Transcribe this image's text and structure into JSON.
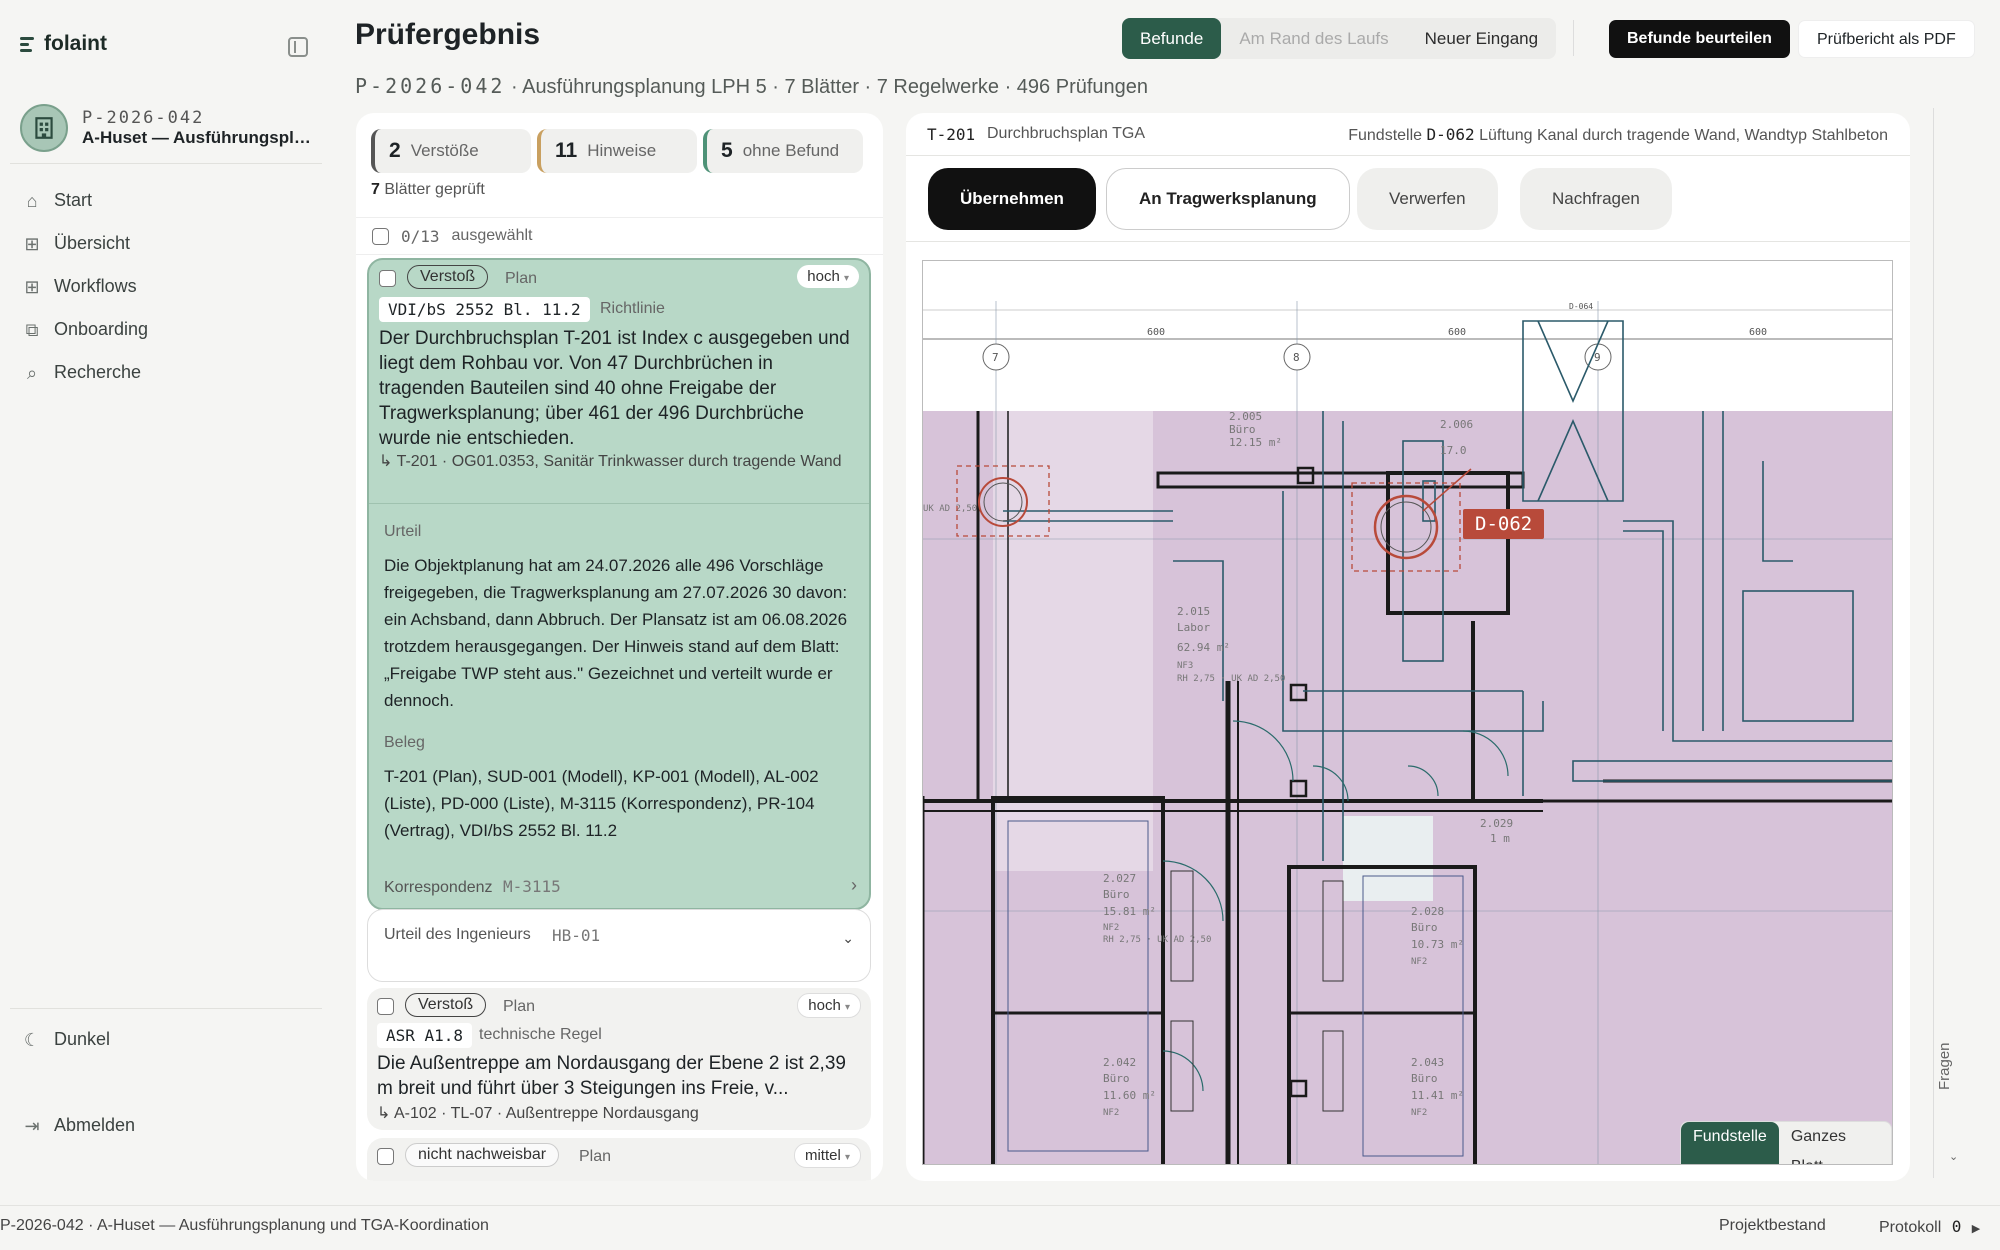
{
  "brand": {
    "name": "folaint"
  },
  "project": {
    "id": "P-2026-042",
    "name": "A-Huset — Ausführungsplanung und TGA-Koordination"
  },
  "nav": {
    "items": [
      {
        "label": "Start",
        "icon": "home-icon"
      },
      {
        "label": "Übersicht",
        "icon": "grid-icon"
      },
      {
        "label": "Workflows",
        "icon": "workflow-icon"
      },
      {
        "label": "Onboarding",
        "icon": "onboarding-icon"
      },
      {
        "label": "Recherche",
        "icon": "search-icon"
      }
    ],
    "dark_label": "Dunkel",
    "logout_label": "Abmelden"
  },
  "header": {
    "title": "Prüfergebnis",
    "subtitle_id": "P-2026-042",
    "subtitle_rest": "· Ausführungsplanung LPH 5 · 7 Blätter · 7 Regelwerke · 496 Prüfungen",
    "tabs": [
      "Befunde",
      "Am Rand des Laufs",
      "Neuer Eingang"
    ],
    "assess_label": "Befunde beurteilen",
    "pdf_label": "Prüfbericht als PDF"
  },
  "summary": {
    "violations_count": "2",
    "violations_label": "Verstöße",
    "hints_count": "11",
    "hints_label": "Hinweise",
    "ok_count": "5",
    "ok_label": "ohne Befund",
    "sheets_count": "7",
    "sheets_label": "Blätter geprüft",
    "selected": "0/13",
    "selected_label": "ausgewählt"
  },
  "findings": [
    {
      "type": "Verstoß",
      "scope": "Plan",
      "severity": "hoch",
      "rule": "VDI/bS 2552 Bl. 11.2",
      "rule_kind": "Richtlinie",
      "text": "Der Durchbruchsplan T-201 ist Index c ausgegeben und liegt dem Rohbau vor. Von 47 Durchbrüchen in tragenden Bauteilen sind 40 ohne Freigabe der Tragwerksplanung; über 461 der 496 Durchbrüche wurde nie entschieden.",
      "ref": "↳ T-201 · OG01.0353, Sanitär Trinkwasser durch tragende Wand",
      "verdict_label": "Urteil",
      "verdict": "Die Objektplanung hat am 24.07.2026 alle 496 Vorschläge freigegeben, die Tragwerksplanung am 27.07.2026 30 davon: ein Achsband, dann Abbruch. Der Plansatz ist am 06.08.2026 trotzdem herausgegangen. Der Hinweis stand auf dem Blatt: „Freigabe TWP steht aus.\" Gezeichnet und verteilt wurde er dennoch.",
      "evidence_label": "Beleg",
      "evidence": "T-201 (Plan), SUD-001 (Modell), KP-001 (Modell), AL-002 (Liste), PD-000 (Liste), M-3115 (Korrespondenz), PR-104 (Vertrag), VDI/bS 2552 Bl. 11.2",
      "corr_label": "Korrespondenz",
      "corr_id": "M-3115"
    },
    {
      "type": "Verstoß",
      "scope": "Plan",
      "severity": "hoch",
      "rule": "ASR A1.8",
      "rule_kind": "technische Regel",
      "text": "Die Außentreppe am Nordausgang der Ebene 2 ist 2,39 m breit und führt über 3 Steigungen ins Freie, v...",
      "ref": "↳ A-102 · TL-07 · Außentreppe Nordausgang"
    },
    {
      "type": "nicht nachweisbar",
      "scope": "Plan",
      "severity": "mittel"
    }
  ],
  "engineer": {
    "label": "Urteil des Ingenieurs",
    "id": "HB-01"
  },
  "plan": {
    "sheet_id": "T-201",
    "sheet_name": "Durchbruchsplan TGA",
    "location_label": "Fundstelle",
    "location_id": "D-062",
    "location_desc": "Lüftung Kanal durch tragende Wand, Wandtyp Stahlbeton",
    "actions": [
      "Übernehmen",
      "An Tragwerksplanung",
      "Verwerfen",
      "Nachfragen"
    ],
    "marker": "D-062",
    "view_modes": [
      "Fundstelle",
      "Ganzes Blatt"
    ],
    "axis_labels": [
      "7",
      "8",
      "9"
    ],
    "dims": [
      "600",
      "600",
      "600",
      "600"
    ],
    "top_tag": "D-064",
    "rooms": [
      {
        "no": "2.005",
        "name": "Büro",
        "area": "12.15 m²"
      },
      {
        "no": "2.006",
        "name": "",
        "area": "17.0"
      },
      {
        "no": "2.015",
        "name": "Labor",
        "area": "62.94 m²",
        "nf": "NF3",
        "rh": "RH 2,75 · UK AD 2,50"
      },
      {
        "no": "2.027",
        "name": "Büro",
        "area": "15.81 m²",
        "nf": "NF2",
        "rh": "RH 2,75 · UK AD 2,50"
      },
      {
        "no": "2.028",
        "name": "Büro",
        "area": "10.73 m²",
        "nf": "NF2"
      },
      {
        "no": "2.029",
        "name": "",
        "area": "1 m"
      },
      {
        "no": "2.042",
        "name": "Büro",
        "area": "11.60 m²",
        "nf": "NF2"
      },
      {
        "no": "2.043",
        "name": "Büro",
        "area": "11.41 m²",
        "nf": "NF2"
      }
    ],
    "side_label": "UK AD 2,50"
  },
  "side": {
    "fragen": "Fragen"
  },
  "footer": {
    "project": "P-2026-042 · A-Huset — Ausführungsplanung und TGA-Koordination",
    "stock": "Projektbestand",
    "log": "Protokoll",
    "log_count": "0"
  },
  "colors": {
    "accent": "#2c5c4a",
    "marker": "#b84a3a",
    "finding_bg": "#b8d8c7",
    "plan_fill": "#d7c3d9"
  }
}
